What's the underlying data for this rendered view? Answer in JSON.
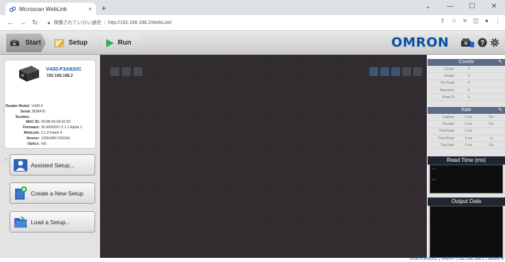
{
  "browser": {
    "tab_title": "Microscan WebLink",
    "tab_close": "×",
    "new_tab": "+",
    "url_warning": "保護されていない通信",
    "url": "http://192.168.188.2/WebLink/"
  },
  "toolbar": {
    "start_label": "Start",
    "setup_label": "Setup",
    "run_label": "Run",
    "brand": "OMRON"
  },
  "device": {
    "model": "V430-F3A920C",
    "ip": "192.168.188.2",
    "info": [
      {
        "key": "Reader Model:",
        "value": "V430-F"
      },
      {
        "key": "Serial Number:",
        "value": "3838476"
      },
      {
        "key": "MAC ID:",
        "value": "00:0B:43:3A:92:9C"
      },
      {
        "key": "Firmware:",
        "value": "35-9000097-2.1.1 Alpha 1"
      },
      {
        "key": "WebLink:",
        "value": "2.1.0 Patch 4"
      },
      {
        "key": "Sensor:",
        "value": "1280x960 (SXGA)"
      },
      {
        "key": "Optics:",
        "value": "HD"
      }
    ]
  },
  "left_buttons": {
    "assisted": "Assisted Setup...",
    "create": "Create a New Setup",
    "load": "Load a Setup..."
  },
  "counts": {
    "title": "Counts",
    "rows": [
      {
        "label": "Cycles",
        "value": "0"
      },
      {
        "label": "Reads",
        "value": "0"
      },
      {
        "label": "No Read",
        "value": "0"
      },
      {
        "label": "Mismatch",
        "value": "0"
      },
      {
        "label": "Read %",
        "value": "0"
      }
    ]
  },
  "rate": {
    "title": "Rate",
    "rows": [
      {
        "label": "Capture",
        "value": "0 ms",
        "unit": "0/s"
      },
      {
        "label": "Decode",
        "value": "0 ms",
        "unit": "0/s"
      },
      {
        "label": "Overhead",
        "value": "0 ms",
        "unit": ""
      },
      {
        "label": "Total Read",
        "value": "0 ms",
        "unit": "/s"
      },
      {
        "label": "Trig Rate",
        "value": "0 ms",
        "unit": "0/s"
      }
    ]
  },
  "read_time": {
    "title": "Read Time (ms)",
    "y1": "1.0",
    "y2": "0.5"
  },
  "output": {
    "title": "Output Data"
  },
  "status": {
    "text": "V430-F3A920C | V430-F | 192.168.188.2 | 3838476"
  }
}
